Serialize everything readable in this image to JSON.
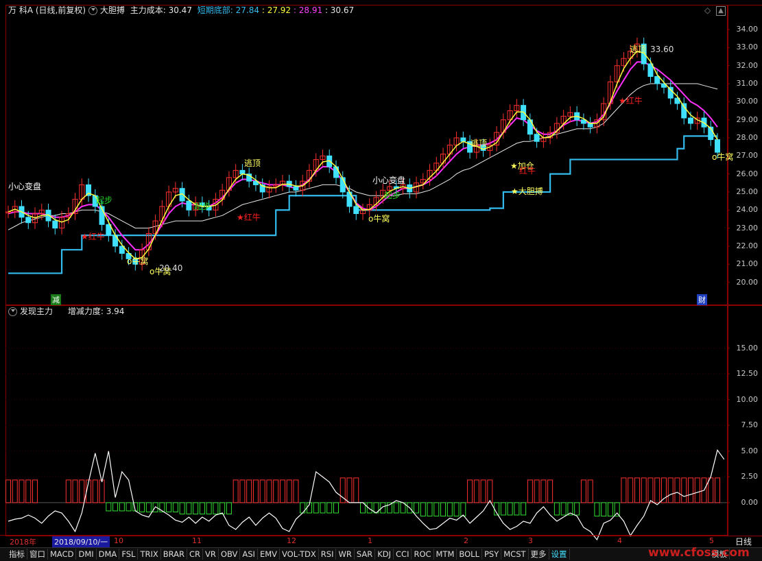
{
  "header": {
    "stock_name": "万 科A",
    "period": "(日线,前复权)",
    "indicator": "大胆搏",
    "cost_label": "主力成本:",
    "cost_value": "30.47",
    "bottom_label": "短期底部:",
    "bottom_value": "27.84",
    "v1": ": 27.92",
    "v2": ": 28.91",
    "v3": ": 30.67"
  },
  "lower_header": {
    "indicator": "发现主力",
    "strength_label": "增减力度:",
    "strength_value": "3.94"
  },
  "right_corner": {
    "label": "日线"
  },
  "markers": {
    "decrease": "减",
    "finance": "财"
  },
  "annotations": [
    {
      "text": "小心变盘",
      "color": "#ffffff"
    },
    {
      "text": "★红牛",
      "color": "#ff2020"
    },
    {
      "text": "起步",
      "color": "#20d020"
    },
    {
      "text": "o牛窝",
      "color": "#ffff60"
    },
    {
      "text": "o牛窝",
      "color": "#ffff60"
    },
    {
      "text": "20.40",
      "color": "#dddddd"
    },
    {
      "text": "起步",
      "color": "#20d020"
    },
    {
      "text": "逃顶",
      "color": "#ffff60"
    },
    {
      "text": "★红牛",
      "color": "#ff2020"
    },
    {
      "text": "小心变盘",
      "color": "#ffffff"
    },
    {
      "text": "起步",
      "color": "#20d020"
    },
    {
      "text": "o牛窝",
      "color": "#ffff60"
    },
    {
      "text": "逃顶",
      "color": "#ffff60"
    },
    {
      "text": "★加仓",
      "color": "#ffff60"
    },
    {
      "text": "红牛",
      "color": "#ff2020"
    },
    {
      "text": "★大胆搏",
      "color": "#ffff60"
    },
    {
      "text": "逃顶",
      "color": "#ffff60"
    },
    {
      "text": "33.60",
      "color": "#dddddd"
    },
    {
      "text": "★红牛",
      "color": "#ff2020"
    },
    {
      "text": "o牛窝",
      "color": "#ffff60"
    }
  ],
  "time_labels": [
    "2018年",
    "2018/09/10/一",
    "10",
    "11",
    "12",
    "1",
    "2",
    "3",
    "4",
    "5"
  ],
  "tabs": [
    "指标",
    "窗口",
    "MACD",
    "DMI",
    "DMA",
    "FSL",
    "TRIX",
    "BRAR",
    "CR",
    "VR",
    "OBV",
    "ASI",
    "EMV",
    "VOL-TDX",
    "RSI",
    "WR",
    "SAR",
    "KDJ",
    "CCI",
    "ROC",
    "MTM",
    "BOLL",
    "PSY",
    "MCST",
    "更多",
    "设置"
  ],
  "tab_right": "模板",
  "watermark": "www.cfoss.com",
  "colors": {
    "up": "#ff3030",
    "down": "#40e0ff",
    "ma_yellow": "#ffff40",
    "ma_magenta": "#ff30ff",
    "ma_white": "#e8e8e8",
    "support": "#33bbee",
    "hist_green": "#30e030"
  },
  "chart_data": [
    {
      "type": "candlestick",
      "ylim": [
        19.3,
        34.8
      ],
      "yticks": [
        "34.00",
        "33.00",
        "32.00",
        "31.00",
        "30.00",
        "29.00",
        "28.00",
        "27.00",
        "26.00",
        "25.00",
        "24.00",
        "23.00",
        "22.00",
        "21.00",
        "20.00"
      ],
      "close": [
        23.9,
        24.2,
        23.6,
        23.3,
        23.8,
        24.0,
        23.4,
        23.0,
        23.6,
        23.8,
        24.6,
        25.4,
        24.8,
        24.2,
        23.2,
        22.6,
        22.0,
        21.6,
        21.3,
        21.0,
        21.8,
        22.7,
        23.4,
        24.2,
        25.0,
        25.2,
        24.5,
        24.0,
        24.4,
        24.2,
        24.0,
        24.6,
        25.1,
        25.8,
        26.2,
        26.0,
        25.6,
        25.4,
        25.0,
        25.3,
        25.4,
        25.6,
        25.3,
        25.1,
        25.6,
        26.2,
        26.8,
        27.0,
        26.4,
        25.8,
        25.0,
        24.2,
        23.8,
        24.0,
        24.3,
        24.7,
        25.1,
        25.3,
        25.2,
        25.4,
        25.0,
        25.5,
        25.7,
        26.2,
        26.6,
        27.1,
        27.6,
        28.0,
        27.8,
        27.2,
        27.6,
        27.3,
        27.6,
        28.3,
        29.0,
        29.5,
        29.8,
        29.0,
        28.2,
        27.8,
        28.0,
        28.3,
        28.8,
        29.2,
        29.4,
        29.0,
        28.8,
        28.6,
        29.0,
        29.9,
        31.1,
        32.0,
        32.4,
        32.8,
        33.2,
        32.1,
        31.4,
        31.0,
        30.8,
        30.2,
        29.9,
        29.1,
        28.8,
        29.1,
        28.6,
        27.9,
        27.2
      ],
      "support": [
        20.5,
        20.5,
        20.5,
        20.5,
        20.5,
        20.5,
        20.5,
        20.5,
        21.8,
        21.8,
        21.8,
        22.6,
        22.6,
        22.6,
        22.6,
        22.6,
        22.6,
        22.6,
        22.6,
        22.6,
        22.6,
        22.6,
        22.6,
        22.6,
        22.6,
        22.6,
        22.6,
        22.6,
        22.6,
        22.6,
        22.6,
        22.6,
        22.6,
        22.6,
        22.6,
        22.6,
        22.6,
        22.6,
        22.6,
        22.6,
        24.0,
        24.0,
        24.8,
        24.8,
        24.8,
        24.8,
        24.8,
        24.8,
        24.8,
        24.8,
        24.8,
        24.8,
        24.0,
        24.0,
        24.0,
        24.0,
        24.0,
        24.0,
        24.0,
        24.0,
        24.0,
        24.0,
        24.0,
        24.0,
        24.0,
        24.0,
        24.0,
        24.0,
        24.0,
        24.0,
        24.0,
        24.0,
        24.1,
        24.1,
        25.0,
        25.0,
        25.0,
        25.0,
        25.0,
        25.0,
        25.0,
        26.0,
        26.0,
        26.0,
        26.8,
        26.8,
        26.8,
        26.8,
        26.8,
        26.8,
        26.8,
        26.8,
        26.8,
        26.8,
        26.8,
        26.8,
        26.8,
        26.8,
        26.8,
        26.8,
        27.4,
        28.1,
        28.1,
        28.1,
        28.1,
        28.1,
        28.1
      ],
      "ma_white": [
        22.9,
        23.1,
        23.3,
        23.4,
        23.5,
        23.6,
        23.7,
        23.7,
        23.8,
        23.8,
        23.9,
        24.0,
        24.0,
        24.0,
        23.9,
        23.8,
        23.6,
        23.4,
        23.2,
        23.0,
        23.0,
        23.0,
        23.1,
        23.2,
        23.3,
        23.4,
        23.4,
        23.4,
        23.4,
        23.4,
        23.5,
        23.6,
        23.7,
        23.9,
        24.1,
        24.3,
        24.4,
        24.5,
        24.6,
        24.7,
        24.8,
        24.9,
        25.0,
        25.0,
        25.1,
        25.2,
        25.3,
        25.4,
        25.4,
        25.4,
        25.3,
        25.2,
        25.0,
        24.9,
        24.8,
        24.8,
        24.8,
        24.8,
        24.8,
        24.9,
        24.9,
        24.9,
        25.0,
        25.1,
        25.3,
        25.5,
        25.7,
        26.0,
        26.2,
        26.3,
        26.5,
        26.7,
        26.9,
        27.1,
        27.3,
        27.5,
        27.7,
        27.8,
        27.8,
        27.9,
        28.0,
        28.1,
        28.2,
        28.3,
        28.4,
        28.5,
        28.5,
        28.5,
        28.6,
        28.8,
        29.2,
        29.6,
        30.0,
        30.4,
        30.7,
        30.9,
        31.0,
        31.0,
        31.0,
        31.0,
        31.0,
        31.0,
        31.0,
        31.0,
        30.9,
        30.8,
        30.7
      ],
      "ma_magenta": [
        23.8,
        23.9,
        23.9,
        23.8,
        23.8,
        23.8,
        23.7,
        23.6,
        23.6,
        23.7,
        23.9,
        24.2,
        24.3,
        24.3,
        24.0,
        23.6,
        23.1,
        22.6,
        22.2,
        21.8,
        21.8,
        22.1,
        22.6,
        23.2,
        23.8,
        24.2,
        24.4,
        24.3,
        24.3,
        24.2,
        24.2,
        24.4,
        24.7,
        25.1,
        25.5,
        25.7,
        25.7,
        25.6,
        25.5,
        25.4,
        25.4,
        25.4,
        25.3,
        25.2,
        25.4,
        25.7,
        26.1,
        26.4,
        26.4,
        26.1,
        25.6,
        25.0,
        24.4,
        24.1,
        24.0,
        24.2,
        24.5,
        24.8,
        25.0,
        25.2,
        25.2,
        25.3,
        25.4,
        25.6,
        25.9,
        26.3,
        26.7,
        27.1,
        27.4,
        27.5,
        27.6,
        27.6,
        27.7,
        27.9,
        28.3,
        28.7,
        29.1,
        29.0,
        28.7,
        28.4,
        28.2,
        28.2,
        28.4,
        28.7,
        28.9,
        29.0,
        28.9,
        28.8,
        28.9,
        29.3,
        29.9,
        30.6,
        31.2,
        31.8,
        32.2,
        32.2,
        32.0,
        31.8,
        31.5,
        31.2,
        30.8,
        30.4,
        30.0,
        29.8,
        29.5,
        29.1,
        28.6
      ]
    },
    {
      "type": "histogram",
      "ylim": [
        -3.0,
        17.5
      ],
      "yticks": [
        "15.00",
        "12.50",
        "10.00",
        "7.50",
        "5.00",
        "2.50",
        "0.00"
      ],
      "bars": [
        2.2,
        2.2,
        2.2,
        2.2,
        2.2,
        0,
        0,
        0,
        0,
        2.2,
        2.2,
        2.2,
        2.2,
        2.2,
        2.2,
        -0.8,
        -0.8,
        -0.8,
        -0.8,
        -0.8,
        -0.9,
        -0.9,
        -0.9,
        -0.9,
        -0.9,
        -0.9,
        -1.1,
        -1.1,
        -1.1,
        -1.1,
        -1.1,
        -1.1,
        -1.1,
        -1.1,
        2.2,
        2.2,
        2.2,
        2.2,
        2.2,
        2.2,
        2.2,
        2.2,
        2.2,
        2.2,
        -1.0,
        -1.0,
        -1.0,
        -1.0,
        -1.0,
        -1.0,
        2.4,
        2.4,
        2.4,
        -1.0,
        -1.0,
        -1.0,
        -1.0,
        -1.0,
        -1.0,
        -1.0,
        -1.0,
        -1.0,
        -1.3,
        -1.3,
        -1.3,
        -1.3,
        -1.3,
        -1.3,
        -1.3,
        2.2,
        2.2,
        2.2,
        2.2,
        -1.2,
        -1.2,
        -1.2,
        -1.2,
        -1.2,
        2.2,
        2.2,
        2.2,
        2.2,
        -1.2,
        -1.2,
        -1.2,
        -1.2,
        2.2,
        2.2,
        -1.3,
        -1.3,
        -1.3,
        -1.3,
        2.4,
        2.4,
        2.4,
        2.4,
        2.4,
        2.4,
        2.4,
        2.4,
        2.4,
        2.4,
        2.4,
        2.4,
        2.4,
        2.4,
        2.4
      ],
      "line": [
        -1.8,
        -1.6,
        -1.5,
        -1.2,
        -1.5,
        -2.0,
        -1.3,
        -0.8,
        -1.0,
        -1.8,
        -2.8,
        -1.0,
        2.0,
        4.8,
        2.0,
        5.0,
        0.5,
        3.0,
        2.2,
        -0.8,
        -1.2,
        -1.4,
        -0.4,
        -0.8,
        -1.2,
        -1.7,
        -1.9,
        -1.4,
        -2.0,
        -1.4,
        -1.8,
        -1.2,
        -1.0,
        -2.2,
        -2.6,
        -1.9,
        -1.4,
        -2.2,
        -1.5,
        -1.0,
        -1.5,
        -2.5,
        -2.8,
        -1.6,
        -1.0,
        -0.2,
        3.0,
        2.5,
        2.0,
        1.0,
        0.5,
        0.0,
        0.0,
        0.0,
        -0.6,
        -1.0,
        -0.4,
        -0.2,
        0.2,
        0.0,
        -0.5,
        -1.3,
        -2.0,
        -2.6,
        -2.5,
        -2.0,
        -1.5,
        -1.7,
        -1.2,
        -2.0,
        -1.4,
        -0.8,
        0.2,
        -1.0,
        -2.0,
        -2.6,
        -2.3,
        -1.8,
        -2.0,
        -1.0,
        -0.4,
        -1.2,
        -1.8,
        -1.4,
        -1.0,
        -1.3,
        -2.4,
        -2.8,
        -3.6,
        -2.0,
        -1.7,
        -1.0,
        -1.8,
        -3.2,
        -2.2,
        -1.3,
        0.2,
        -0.2,
        0.4,
        0.8,
        1.0,
        0.6,
        0.8,
        1.0,
        1.2,
        2.5,
        5.1,
        4.2
      ]
    }
  ]
}
